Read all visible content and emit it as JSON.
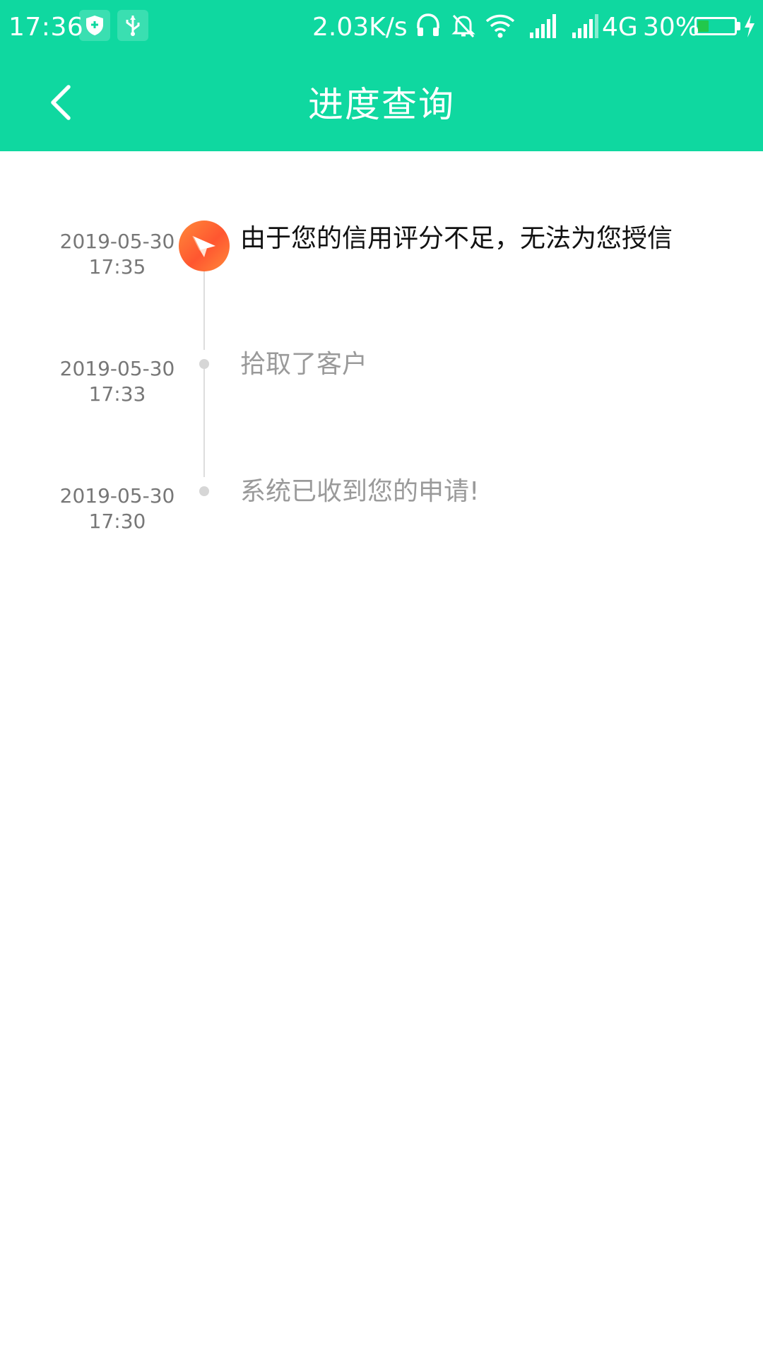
{
  "status_bar": {
    "time": "17:36",
    "network_speed": "2.03K/s",
    "network_type": "4G",
    "battery_percent_text": "30%",
    "battery_level": 0.3
  },
  "header": {
    "title": "进度查询",
    "background_color": "#0fd8a0"
  },
  "timeline": {
    "events": [
      {
        "date": "2019-05-30",
        "time": "17:35",
        "text": "由于您的信用评分不足，无法为您授信",
        "state": "active"
      },
      {
        "date": "2019-05-30",
        "time": "17:33",
        "text": "拾取了客户",
        "state": "past"
      },
      {
        "date": "2019-05-30",
        "time": "17:30",
        "text": "系统已收到您的申请!",
        "state": "past"
      }
    ]
  },
  "icons": {
    "back": "chevron-left-icon",
    "active_event": "paper-plane-icon"
  }
}
